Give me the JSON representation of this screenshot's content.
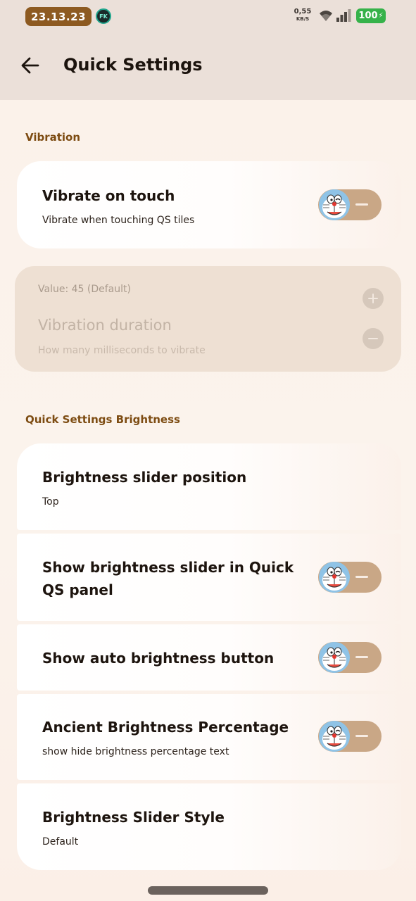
{
  "status_bar": {
    "time": "23.13.23",
    "app_badge": "FK",
    "net_speed": "0,55",
    "net_unit": "KB/S",
    "battery": "100"
  },
  "header": {
    "title": "Quick Settings"
  },
  "sections": {
    "vibration": {
      "title": "Vibration",
      "vibrate_on_touch": {
        "title": "Vibrate on touch",
        "subtitle": "Vibrate when touching QS tiles",
        "enabled": false
      },
      "vibration_duration": {
        "value_text": "Value: 45 (Default)",
        "title": "Vibration duration",
        "subtitle": "How many milliseconds to vibrate",
        "plus": "+",
        "minus": "−"
      }
    },
    "brightness": {
      "title": "Quick Settings Brightness",
      "slider_position": {
        "title": "Brightness slider position",
        "subtitle": "Top"
      },
      "show_in_quick_qs": {
        "title": "Show brightness slider in Quick QS panel",
        "enabled": false
      },
      "auto_brightness": {
        "title": "Show auto brightness button",
        "enabled": false
      },
      "brightness_percentage": {
        "title": "Ancient Brightness Percentage",
        "subtitle": "show hide brightness percentage text",
        "enabled": false
      },
      "slider_style": {
        "title": "Brightness Slider Style",
        "subtitle": "Default"
      }
    }
  },
  "colors": {
    "accent": "#8d5a21",
    "section_title": "#7d4c12",
    "toggle_track": "#c9a786",
    "battery": "#36b24a"
  }
}
